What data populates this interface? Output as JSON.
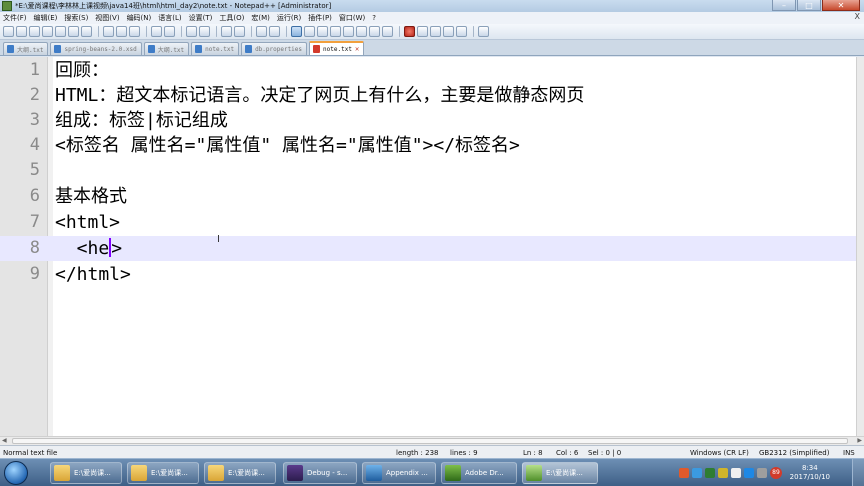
{
  "window": {
    "title": "*E:\\爱尚课程\\李林林上课视频\\java14班\\html\\html_day2\\note.txt - Notepad++ [Administrator]",
    "buttons": {
      "minimize": "–",
      "maximize": "□",
      "close": "✕"
    }
  },
  "menu": {
    "items": [
      "文件(F)",
      "编辑(E)",
      "搜索(S)",
      "视图(V)",
      "编码(N)",
      "语言(L)",
      "设置(T)",
      "工具(O)",
      "宏(M)",
      "运行(R)",
      "插件(P)",
      "窗口(W)",
      "?"
    ],
    "close": "X"
  },
  "tabs": [
    {
      "label": "大纲.txt",
      "active": false
    },
    {
      "label": "spring-beans-2.0.xsd",
      "active": false
    },
    {
      "label": "大纲.txt",
      "active": false
    },
    {
      "label": "note.txt",
      "active": false
    },
    {
      "label": "db.properties",
      "active": false
    },
    {
      "label": "note.txt",
      "active": true
    }
  ],
  "editor": {
    "lines": [
      {
        "num": "1",
        "text": "回顾："
      },
      {
        "num": "2",
        "text": "HTML：超文本标记语言。决定了网页上有什么，主要是做静态网页"
      },
      {
        "num": "3",
        "text": "组成：标签|标记组成"
      },
      {
        "num": "4",
        "text": "<标签名 属性名=\"属性值\" 属性名=\"属性值\"></标签名>"
      },
      {
        "num": "5",
        "text": ""
      },
      {
        "num": "6",
        "text": "基本格式"
      },
      {
        "num": "7",
        "text": "<html>"
      },
      {
        "num": "8",
        "text": "  <he",
        "after_caret": ">"
      },
      {
        "num": "9",
        "text": "</html>"
      }
    ],
    "current_line": 8
  },
  "status": {
    "file_type": "Normal text file",
    "length": "length : 238",
    "lines": "lines : 9",
    "ln": "Ln : 8",
    "col": "Col : 6",
    "sel": "Sel : 0 | 0",
    "eol": "Windows (CR LF)",
    "encoding": "GB2312 (Simplified)",
    "mode": "INS"
  },
  "taskbar": {
    "tasks": [
      {
        "label": "E:\\爱尚课...",
        "icon": "folder-icon"
      },
      {
        "label": "E:\\爱尚课...",
        "icon": "folder-icon"
      },
      {
        "label": "E:\\爱尚课...",
        "icon": "folder-icon"
      },
      {
        "label": "Debug - s...",
        "icon": "eclipse-icon"
      },
      {
        "label": "Appendix ...",
        "icon": "appendix-icon"
      },
      {
        "label": "Adobe Dr...",
        "icon": "dreamweaver-icon"
      },
      {
        "label": "E:\\爱尚课...",
        "icon": "notepadpp-icon",
        "active": true
      }
    ],
    "tray_badge": "89",
    "time": "8:34",
    "date": "2017/10/10"
  }
}
